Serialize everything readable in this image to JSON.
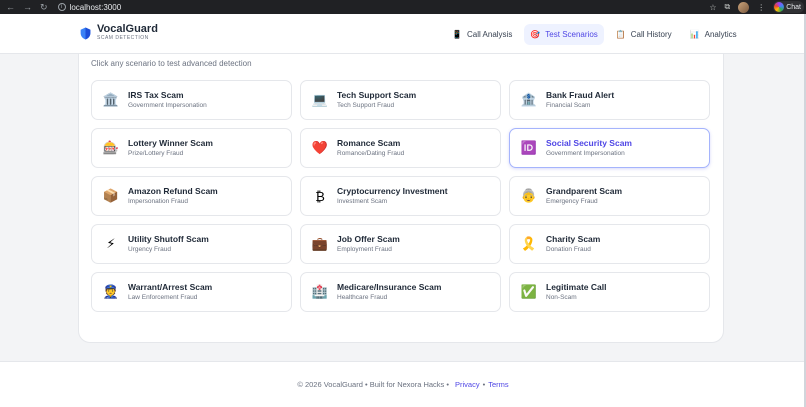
{
  "browser": {
    "url": "localhost:3000",
    "chat_label": "Chat"
  },
  "header": {
    "brand_name": "VocalGuard",
    "brand_tagline": "SCAM DETECTION",
    "tabs": [
      {
        "label": "Call Analysis",
        "icon": "📱",
        "active": false
      },
      {
        "label": "Test Scenarios",
        "icon": "🎯",
        "active": true
      },
      {
        "label": "Call History",
        "icon": "📋",
        "active": false
      },
      {
        "label": "Analytics",
        "icon": "📊",
        "active": false
      }
    ]
  },
  "main": {
    "subtitle": "Click any scenario to test advanced detection",
    "scenarios": [
      {
        "title": "IRS Tax Scam",
        "category": "Government Impersonation",
        "icon": "🏛️"
      },
      {
        "title": "Tech Support Scam",
        "category": "Tech Support Fraud",
        "icon": "💻"
      },
      {
        "title": "Bank Fraud Alert",
        "category": "Financial Scam",
        "icon": "🏦"
      },
      {
        "title": "Lottery Winner Scam",
        "category": "Prize/Lottery Fraud",
        "icon": "🎰"
      },
      {
        "title": "Romance Scam",
        "category": "Romance/Dating Fraud",
        "icon": "❤️"
      },
      {
        "title": "Social Security Scam",
        "category": "Government Impersonation",
        "icon": "🆔"
      },
      {
        "title": "Amazon Refund Scam",
        "category": "Impersonation Fraud",
        "icon": "📦"
      },
      {
        "title": "Cryptocurrency Investment",
        "category": "Investment Scam",
        "icon": "₿"
      },
      {
        "title": "Grandparent Scam",
        "category": "Emergency Fraud",
        "icon": "👵"
      },
      {
        "title": "Utility Shutoff Scam",
        "category": "Urgency Fraud",
        "icon": "⚡"
      },
      {
        "title": "Job Offer Scam",
        "category": "Employment Fraud",
        "icon": "💼"
      },
      {
        "title": "Charity Scam",
        "category": "Donation Fraud",
        "icon": "🎗️"
      },
      {
        "title": "Warrant/Arrest Scam",
        "category": "Law Enforcement Fraud",
        "icon": "👮"
      },
      {
        "title": "Medicare/Insurance Scam",
        "category": "Healthcare Fraud",
        "icon": "🏥"
      },
      {
        "title": "Legitimate Call",
        "category": "Non-Scam",
        "icon": "✅"
      }
    ],
    "selected_index": 5
  },
  "footer": {
    "text": "© 2026 VocalGuard • Built for Nexora Hacks •",
    "privacy": "Privacy",
    "bullet": "•",
    "terms": "Terms"
  }
}
